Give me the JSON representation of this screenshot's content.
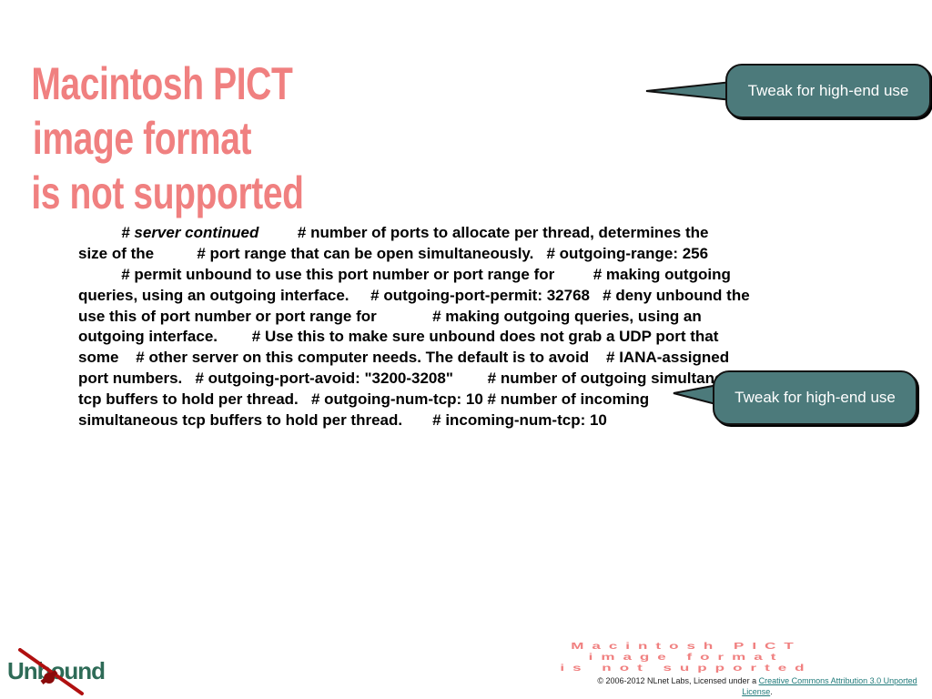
{
  "placeholder_image_top": {
    "lines": [
      "Macintosh PICT",
      "image format",
      "is not supported"
    ]
  },
  "slide_body": {
    "lines": [
      {
        "indent": "          ",
        "italic": "# server continued",
        "rest": "         # number of ports to allocate per thread, determines the"
      },
      {
        "indent": "",
        "italic": "",
        "rest": "size of the          # port range that can be open simultaneously.   # outgoing-range: 256"
      },
      {
        "indent": "          ",
        "italic": "",
        "rest": "# permit unbound to use this port number or port range for         # making outgoing"
      },
      {
        "indent": "",
        "italic": "",
        "rest": "queries, using an outgoing interface.     # outgoing-port-permit: 32768   # deny unbound the"
      },
      {
        "indent": "",
        "italic": "",
        "rest": "use this of port number or port range for             # making outgoing queries, using an"
      },
      {
        "indent": "",
        "italic": "",
        "rest": "outgoing interface.        # Use this to make sure unbound does not grab a UDP port that"
      },
      {
        "indent": "",
        "italic": "",
        "rest": "some    # other server on this computer needs. The default is to avoid    # IANA-assigned"
      },
      {
        "indent": "",
        "italic": "",
        "rest": "port numbers.   # outgoing-port-avoid: \"3200-3208\"        # number of outgoing simultaneous"
      },
      {
        "indent": "",
        "italic": "",
        "rest": "tcp buffers to hold per thread.   # outgoing-num-tcp: 10 # number of incoming"
      },
      {
        "indent": "",
        "italic": "",
        "rest": "simultaneous tcp buffers to hold per thread.       # incoming-num-tcp: 10"
      }
    ]
  },
  "callouts": [
    {
      "text": "Tweak for high-end use"
    },
    {
      "text": "Tweak for high-end use"
    }
  ],
  "logo": {
    "text": "Unbound"
  },
  "placeholder_image_bottom": {
    "lines": [
      "Macintosh PICT",
      "image format",
      "is not supported"
    ]
  },
  "footer": {
    "prefix": "© 2006-2012 NLnet Labs, Licensed under a ",
    "link_text": "Creative Commons Attribution 3.0 Unported License",
    "suffix": "."
  },
  "colors": {
    "callout_fill": "#4c7a7b",
    "placeholder_text": "#f08080",
    "logo": "#2e6b57",
    "link": "#1f7a7a"
  }
}
